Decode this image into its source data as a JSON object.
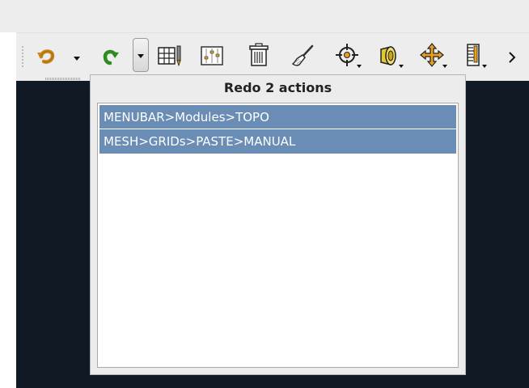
{
  "toolbar": {
    "icons": [
      "undo-icon",
      "undo-dropdown-arrow-icon",
      "redo-icon",
      "redo-dropdown-arrow-icon",
      "grid-edit-icon",
      "grid-settings-icon",
      "trash-icon",
      "brush-icon",
      "crosshair-select-icon",
      "zoom-icon",
      "move-icon",
      "ruler-icon",
      "more-chevron-icon"
    ]
  },
  "popup": {
    "title": "Redo 2 actions",
    "items": [
      {
        "label": "MENUBAR>Modules>TOPO"
      },
      {
        "label": "MESH>GRIDs>PASTE>MANUAL"
      }
    ]
  },
  "colors": {
    "toolbar_bg": "#ededed",
    "viewport_bg": "#0f1a24",
    "selection_bg": "#6a8db5"
  }
}
